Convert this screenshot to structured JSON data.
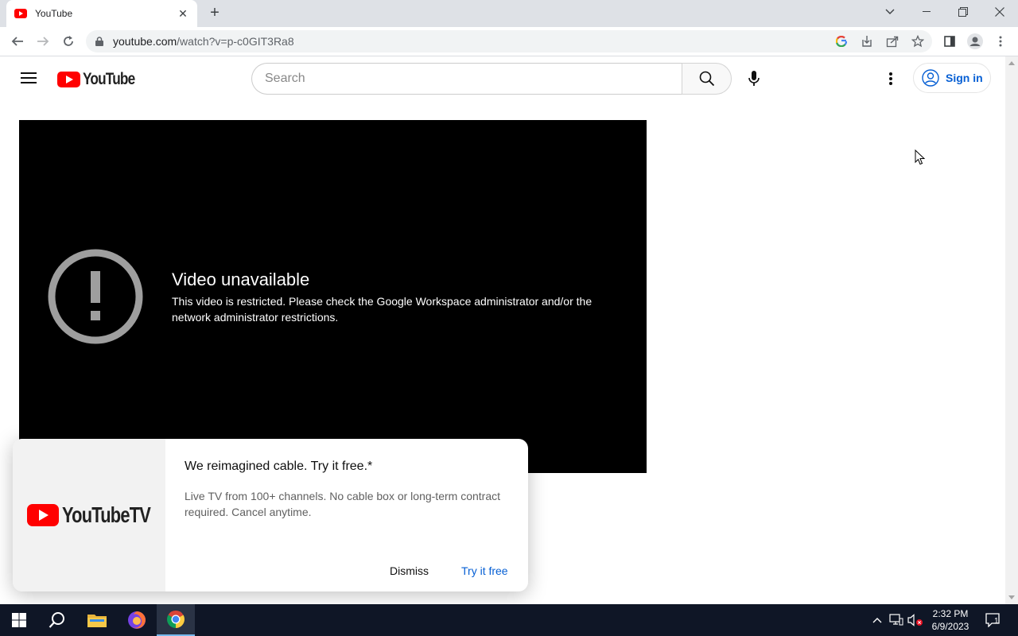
{
  "browser": {
    "tab_title": "YouTube",
    "url_host": "youtube.com",
    "url_path": "/watch?v=p-c0GIT3Ra8"
  },
  "youtube": {
    "logo_text": "YouTube",
    "search_placeholder": "Search",
    "signin_label": "Sign in"
  },
  "player": {
    "error_title": "Video unavailable",
    "error_message": "This video is restricted. Please check the Google Workspace administrator and/or the network administrator restrictions."
  },
  "promo": {
    "logo_text": "YouTubeTV",
    "headline": "We reimagined cable. Try it free.*",
    "body": "Live TV from 100+ channels. No cable box or long-term contract required. Cancel anytime.",
    "dismiss_label": "Dismiss",
    "try_label": "Try it free"
  },
  "taskbar": {
    "time": "2:32 PM",
    "date": "6/9/2023",
    "notification_count": "1"
  },
  "colors": {
    "youtube_red": "#ff0000",
    "link_blue": "#065fd4",
    "taskbar_bg": "#0f1626"
  }
}
